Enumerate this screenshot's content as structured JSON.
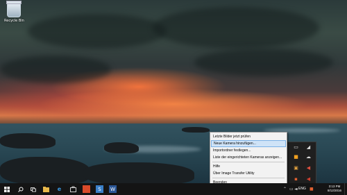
{
  "desktop": {
    "recycle_bin_label": "Recycle Bin"
  },
  "context_menu": {
    "items": [
      {
        "label": "Letzte Bilder jetzt prüfen"
      },
      {
        "label": "Neue Kamera hinzufügen...",
        "highlighted": true
      },
      {
        "label": "Importordner festlegen..."
      },
      {
        "label": "Liste der eingerichteten Kameras anzeigen..."
      },
      {
        "label": "Hilfe"
      },
      {
        "label": "Über Image Transfer Utility"
      },
      {
        "label": "Beenden"
      }
    ]
  },
  "taskbar": {
    "language": "ENG",
    "time": "3:13 PM",
    "date": "8/12/2016",
    "pinned_icons": [
      "windows-start-icon",
      "search-icon",
      "task-view-icon",
      "file-explorer-icon",
      "edge-icon",
      "store-icon",
      "app-red-icon",
      "app-s-icon",
      "word-icon"
    ]
  },
  "colors": {
    "taskbar_bg": "#141414",
    "menu_bg": "#f2f2f2",
    "menu_highlight": "#cfe3f7",
    "accent": "#1e6ec8"
  }
}
